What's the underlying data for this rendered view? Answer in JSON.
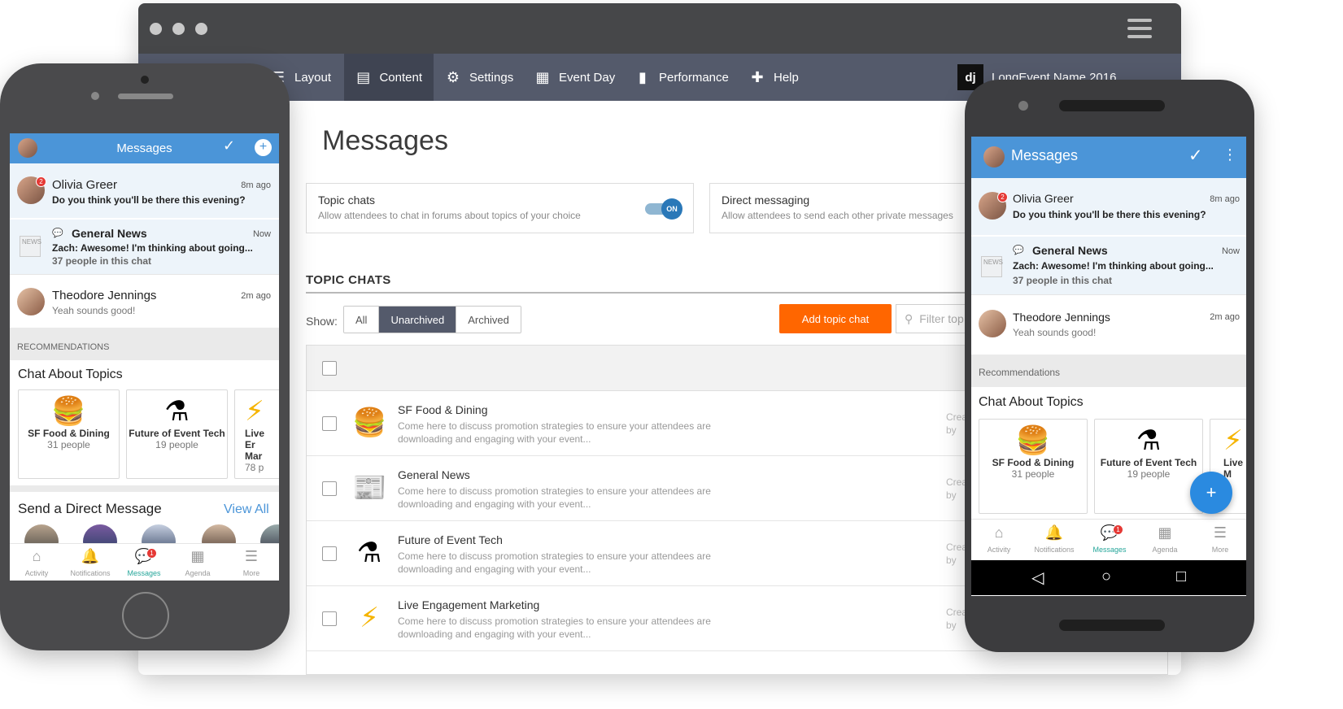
{
  "desktop": {
    "nav": {
      "items": [
        {
          "label": "Layout",
          "icon": "layout-icon"
        },
        {
          "label": "Content",
          "icon": "document-icon",
          "active": true
        },
        {
          "label": "Settings",
          "icon": "gear-icon"
        },
        {
          "label": "Event Day",
          "icon": "calendar-icon"
        },
        {
          "label": "Performance",
          "icon": "bar-chart-icon"
        },
        {
          "label": "Help",
          "icon": "help-kit-icon"
        }
      ],
      "brand_logo": "dj",
      "event_name": "LongEvent Name 2016"
    },
    "page_title": "Messages",
    "settings": {
      "topic_chats": {
        "title": "Topic chats",
        "desc": "Allow attendees to chat in forums about topics of your choice",
        "toggle": "ON"
      },
      "direct_messaging": {
        "title": "Direct messaging",
        "desc": "Allow attendees to send each other private messages"
      }
    },
    "section_title": "TOPIC CHATS",
    "show_label": "Show:",
    "filters": [
      "All",
      "Unarchived",
      "Archived"
    ],
    "active_filter": "Unarchived",
    "add_button": "Add topic chat",
    "filter_placeholder": "Filter top",
    "rows": [
      {
        "name": "SF Food & Dining",
        "desc": "Come here to discuss promotion strategies to ensure your attendees are downloading and engaging with your event...",
        "icon": "burger-icon",
        "created": "Crea",
        "by": "by"
      },
      {
        "name": "General News",
        "desc": "Come here to discuss promotion strategies to ensure your attendees are downloading and engaging with your event...",
        "icon": "newspaper-icon",
        "created": "Crea",
        "by": "by"
      },
      {
        "name": "Future of Event Tech",
        "desc": "Come here to discuss promotion strategies to ensure your attendees are downloading and engaging with your event...",
        "icon": "flask-icon",
        "created": "Crea",
        "by": "by"
      },
      {
        "name": "Live Engagement Marketing",
        "desc": "Come here to discuss promotion strategies to ensure your attendees are downloading and engaging with your event...",
        "icon": "lightning-icon",
        "created": "Crea",
        "by": "by"
      }
    ]
  },
  "iphone": {
    "header_title": "Messages",
    "messages": [
      {
        "name": "Olivia Greer",
        "time": "8m ago",
        "text": "Do you think you'll be there this evening?",
        "badge": "2"
      },
      {
        "name": "General News",
        "time": "Now",
        "text": "Zach: Awesome! I'm thinking about going...",
        "sub": "37 people in this chat"
      },
      {
        "name": "Theodore Jennings",
        "time": "2m ago",
        "text": "Yeah sounds good!"
      }
    ],
    "rec_label": "RECOMMENDATIONS",
    "chat_about": "Chat About Topics",
    "topics": [
      {
        "name": "SF Food & Dining",
        "count": "31 people"
      },
      {
        "name": "Future of Event Tech",
        "count": "19 people"
      },
      {
        "name": "Live Er Mar",
        "count": "78 p"
      }
    ],
    "dm_title": "Send a Direct Message",
    "view_all": "View All",
    "tabs": [
      "Activity",
      "Notifications",
      "Messages",
      "Agenda",
      "More"
    ],
    "tab_badge": "1"
  },
  "android": {
    "header_title": "Messages",
    "messages": [
      {
        "name": "Olivia Greer",
        "time": "8m ago",
        "text": "Do you think you'll be there this evening?",
        "badge": "2"
      },
      {
        "name": "General News",
        "time": "Now",
        "text": "Zach: Awesome! I'm thinking about going...",
        "sub": "37 people in this chat"
      },
      {
        "name": "Theodore Jennings",
        "time": "2m ago",
        "text": "Yeah sounds good!"
      }
    ],
    "rec_label": "Recommendations",
    "chat_about": "Chat About Topics",
    "topics": [
      {
        "name": "SF Food & Dining",
        "count": "31 people"
      },
      {
        "name": "Future of Event Tech",
        "count": "19 people"
      },
      {
        "name": "Live M",
        "count": "7"
      }
    ],
    "tabs": [
      "Activity",
      "Notifications",
      "Messages",
      "Agenda",
      "More"
    ],
    "tab_badge": "1"
  },
  "colors": {
    "accent_blue": "#4b95d8",
    "nav_dark": "#545a6b",
    "orange": "#ff6600",
    "teal_active": "#26a69a"
  }
}
